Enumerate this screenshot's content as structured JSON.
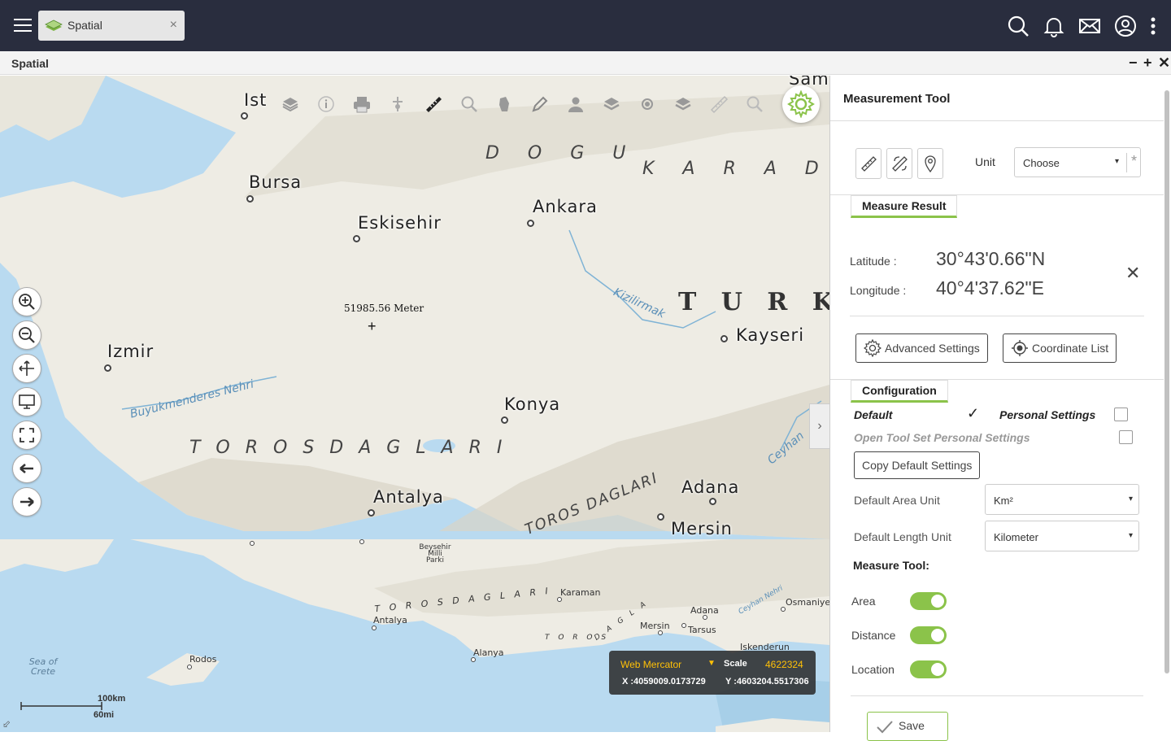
{
  "app": {
    "tab_label": "Spatial",
    "tab_close": "×",
    "window_title": "Spatial",
    "window_controls": [
      "−",
      "+",
      "✕"
    ],
    "top_icons": [
      "search-icon",
      "bell-icon",
      "mail-icon",
      "user-icon",
      "more-vertical-icon"
    ]
  },
  "map": {
    "cities": [
      {
        "label": "Ist"
      },
      {
        "label": "Bursa"
      },
      {
        "label": "Eskisehir"
      },
      {
        "label": "Ankara"
      },
      {
        "label": "Izmir"
      },
      {
        "label": "Kayseri"
      },
      {
        "label": "Konya"
      },
      {
        "label": "Antalya"
      },
      {
        "label": "Adana"
      },
      {
        "label": "Mersin"
      },
      {
        "label": "Sam"
      }
    ],
    "regions": {
      "dogu": "D O G U",
      "karade": "K A R A D E",
      "turkey": "T U R K E Y",
      "toros": "T O R O S  D A G L A R I",
      "toros2": "TOROS DAGLARI"
    },
    "rivers": {
      "kizilirmak": "Kizilirmak",
      "buyukmenderes": "Buyukmenderes Nehri",
      "ceyhan": "Ceyhan"
    },
    "lower": {
      "beysehir": "Beysehir Milli Parki",
      "toros": "T O R O S   D A G L A R I",
      "karaman": "Karaman",
      "antalya": "Antalya",
      "adana": "Adana",
      "osmaniye": "Osmaniye",
      "mersin": "Mersin",
      "tarsus": "Tarsus",
      "toros_small": "T O R O S",
      "alanya": "Alanya",
      "iskenderun": "Iskenderun",
      "rodos": "Rodos",
      "sea_of_crete": "Sea of Crete",
      "ceyhan_nehri": "Ceyhan Nehri",
      "dagla": "D A G L A"
    },
    "measure_label": "51985.56 Meter",
    "crosshair": "+",
    "toolbar": [
      "layers-icon",
      "info-icon",
      "print-icon",
      "select-icon",
      "ruler-icon",
      "search-icon",
      "pointer-icon",
      "pencil-icon",
      "person-icon",
      "layers2-icon",
      "target-icon",
      "layers3-icon",
      "measure-icon",
      "zoom-search-icon"
    ],
    "left_controls": [
      "zoom-in-icon",
      "zoom-out-icon",
      "pan-icon",
      "monitor-icon",
      "fullscreen-icon",
      "back-arrow-icon",
      "forward-arrow-icon"
    ],
    "collapse_arrow": "›",
    "projection": "Web Mercator",
    "projection_arrow": "▼",
    "scale_label": "Scale",
    "scale_value": "4622324",
    "x_coord": "X :4059009.0173729",
    "y_coord": "Y :4603204.5517306",
    "scalebar": {
      "km": "100km",
      "mi": "60mi"
    },
    "resize_icon": "⬃"
  },
  "panel": {
    "title": "Measurement Tool",
    "unit_label": "Unit",
    "unit_value": "Choose",
    "select_arrow": "▾",
    "unit_clear": "*",
    "measure_result_tab": "Measure Result",
    "latitude_label": "Latitude :",
    "latitude_value": "30°43'0.66\"N",
    "longitude_label": "Longitude :",
    "longitude_value": "40°4'37.62\"E",
    "result_close": "✕",
    "advanced_settings": "Advanced Settings",
    "coordinate_list": "Coordinate List",
    "configuration_tab": "Configuration",
    "default_label": "Default",
    "default_check": "✓",
    "personal_settings": "Personal Settings",
    "open_tool_set": "Open Tool Set Personal Settings",
    "copy_default": "Copy Default Settings",
    "default_area_unit_label": "Default Area Unit",
    "default_area_unit_value": "Km²",
    "default_length_unit_label": "Default Length Unit",
    "default_length_unit_value": "Kilometer",
    "measure_tool_heading": "Measure Tool:",
    "toggles": [
      {
        "label": "Area",
        "on": true
      },
      {
        "label": "Distance",
        "on": true
      },
      {
        "label": "Location",
        "on": true
      }
    ],
    "save": "Save",
    "accent": "#8bc34a"
  }
}
